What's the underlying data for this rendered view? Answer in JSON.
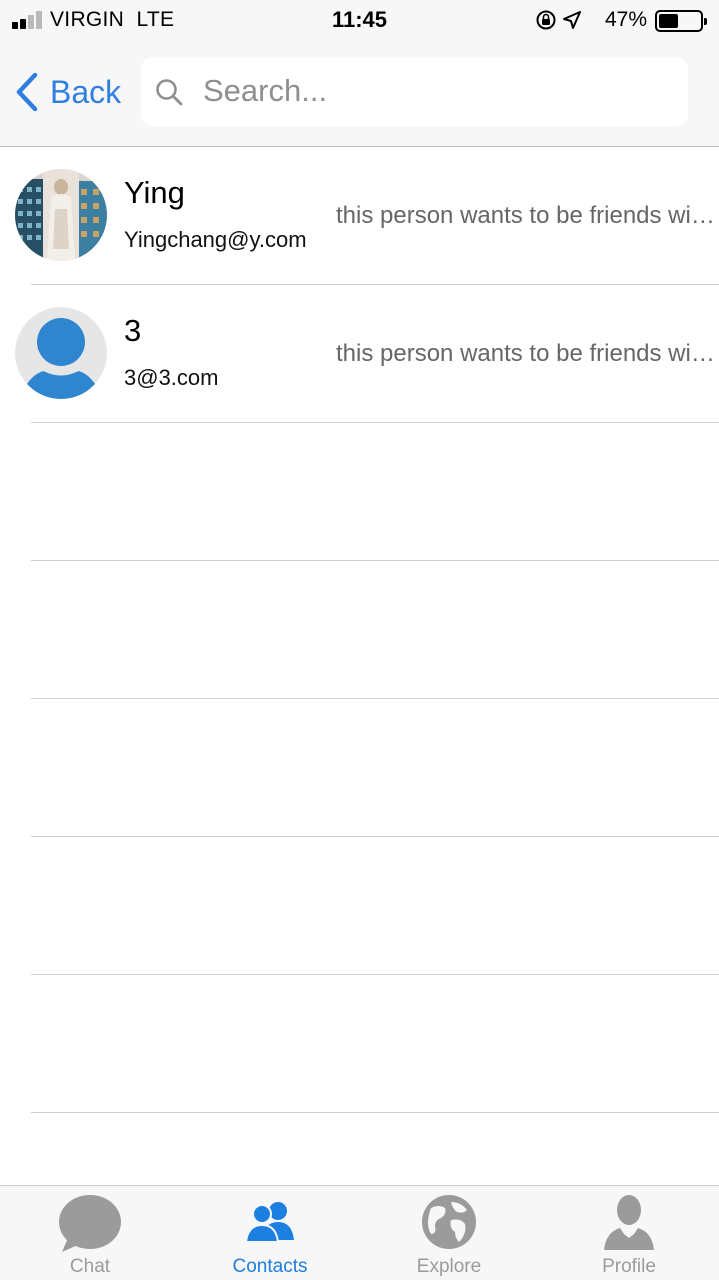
{
  "status_bar": {
    "carrier": "VIRGIN",
    "network": "LTE",
    "time": "11:45",
    "battery_percent": "47%",
    "battery_level": 0.47
  },
  "nav": {
    "back_label": "Back",
    "search_placeholder": "Search..."
  },
  "contacts": [
    {
      "name": "Ying",
      "email": "Yingchang@y.com",
      "status": "this person wants to be friends with you",
      "avatar": "photo"
    },
    {
      "name": "3",
      "email": "3@3.com",
      "status": "this person wants to be friends with you",
      "avatar": "default-person"
    }
  ],
  "tabs": [
    {
      "label": "Chat",
      "icon": "chat-bubble-icon",
      "active": false
    },
    {
      "label": "Contacts",
      "icon": "contacts-icon",
      "active": true
    },
    {
      "label": "Explore",
      "icon": "globe-icon",
      "active": false
    },
    {
      "label": "Profile",
      "icon": "person-icon",
      "active": false
    }
  ],
  "colors": {
    "accent": "#1d7fe0",
    "inactive": "#9b9b9b",
    "avatar_blue": "#2f86cf"
  }
}
